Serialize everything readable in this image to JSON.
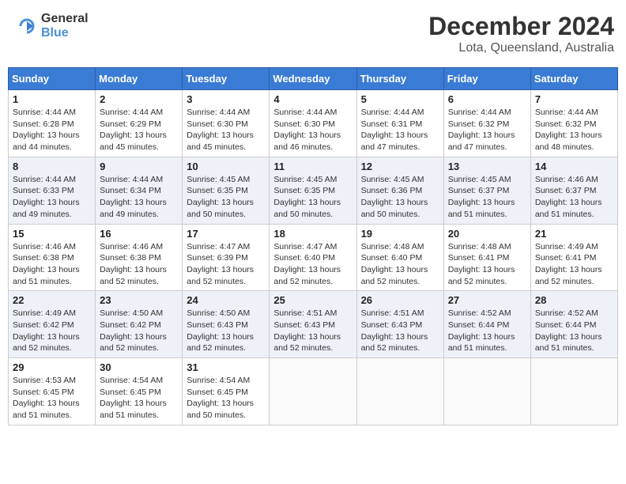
{
  "header": {
    "logo_general": "General",
    "logo_blue": "Blue",
    "month_title": "December 2024",
    "location": "Lota, Queensland, Australia"
  },
  "days_of_week": [
    "Sunday",
    "Monday",
    "Tuesday",
    "Wednesday",
    "Thursday",
    "Friday",
    "Saturday"
  ],
  "weeks": [
    [
      {
        "day": "1",
        "sunrise": "4:44 AM",
        "sunset": "6:28 PM",
        "daylight": "13 hours and 44 minutes."
      },
      {
        "day": "2",
        "sunrise": "4:44 AM",
        "sunset": "6:29 PM",
        "daylight": "13 hours and 45 minutes."
      },
      {
        "day": "3",
        "sunrise": "4:44 AM",
        "sunset": "6:30 PM",
        "daylight": "13 hours and 45 minutes."
      },
      {
        "day": "4",
        "sunrise": "4:44 AM",
        "sunset": "6:30 PM",
        "daylight": "13 hours and 46 minutes."
      },
      {
        "day": "5",
        "sunrise": "4:44 AM",
        "sunset": "6:31 PM",
        "daylight": "13 hours and 47 minutes."
      },
      {
        "day": "6",
        "sunrise": "4:44 AM",
        "sunset": "6:32 PM",
        "daylight": "13 hours and 47 minutes."
      },
      {
        "day": "7",
        "sunrise": "4:44 AM",
        "sunset": "6:32 PM",
        "daylight": "13 hours and 48 minutes."
      }
    ],
    [
      {
        "day": "8",
        "sunrise": "4:44 AM",
        "sunset": "6:33 PM",
        "daylight": "13 hours and 49 minutes."
      },
      {
        "day": "9",
        "sunrise": "4:44 AM",
        "sunset": "6:34 PM",
        "daylight": "13 hours and 49 minutes."
      },
      {
        "day": "10",
        "sunrise": "4:45 AM",
        "sunset": "6:35 PM",
        "daylight": "13 hours and 50 minutes."
      },
      {
        "day": "11",
        "sunrise": "4:45 AM",
        "sunset": "6:35 PM",
        "daylight": "13 hours and 50 minutes."
      },
      {
        "day": "12",
        "sunrise": "4:45 AM",
        "sunset": "6:36 PM",
        "daylight": "13 hours and 50 minutes."
      },
      {
        "day": "13",
        "sunrise": "4:45 AM",
        "sunset": "6:37 PM",
        "daylight": "13 hours and 51 minutes."
      },
      {
        "day": "14",
        "sunrise": "4:46 AM",
        "sunset": "6:37 PM",
        "daylight": "13 hours and 51 minutes."
      }
    ],
    [
      {
        "day": "15",
        "sunrise": "4:46 AM",
        "sunset": "6:38 PM",
        "daylight": "13 hours and 51 minutes."
      },
      {
        "day": "16",
        "sunrise": "4:46 AM",
        "sunset": "6:38 PM",
        "daylight": "13 hours and 52 minutes."
      },
      {
        "day": "17",
        "sunrise": "4:47 AM",
        "sunset": "6:39 PM",
        "daylight": "13 hours and 52 minutes."
      },
      {
        "day": "18",
        "sunrise": "4:47 AM",
        "sunset": "6:40 PM",
        "daylight": "13 hours and 52 minutes."
      },
      {
        "day": "19",
        "sunrise": "4:48 AM",
        "sunset": "6:40 PM",
        "daylight": "13 hours and 52 minutes."
      },
      {
        "day": "20",
        "sunrise": "4:48 AM",
        "sunset": "6:41 PM",
        "daylight": "13 hours and 52 minutes."
      },
      {
        "day": "21",
        "sunrise": "4:49 AM",
        "sunset": "6:41 PM",
        "daylight": "13 hours and 52 minutes."
      }
    ],
    [
      {
        "day": "22",
        "sunrise": "4:49 AM",
        "sunset": "6:42 PM",
        "daylight": "13 hours and 52 minutes."
      },
      {
        "day": "23",
        "sunrise": "4:50 AM",
        "sunset": "6:42 PM",
        "daylight": "13 hours and 52 minutes."
      },
      {
        "day": "24",
        "sunrise": "4:50 AM",
        "sunset": "6:43 PM",
        "daylight": "13 hours and 52 minutes."
      },
      {
        "day": "25",
        "sunrise": "4:51 AM",
        "sunset": "6:43 PM",
        "daylight": "13 hours and 52 minutes."
      },
      {
        "day": "26",
        "sunrise": "4:51 AM",
        "sunset": "6:43 PM",
        "daylight": "13 hours and 52 minutes."
      },
      {
        "day": "27",
        "sunrise": "4:52 AM",
        "sunset": "6:44 PM",
        "daylight": "13 hours and 51 minutes."
      },
      {
        "day": "28",
        "sunrise": "4:52 AM",
        "sunset": "6:44 PM",
        "daylight": "13 hours and 51 minutes."
      }
    ],
    [
      {
        "day": "29",
        "sunrise": "4:53 AM",
        "sunset": "6:45 PM",
        "daylight": "13 hours and 51 minutes."
      },
      {
        "day": "30",
        "sunrise": "4:54 AM",
        "sunset": "6:45 PM",
        "daylight": "13 hours and 51 minutes."
      },
      {
        "day": "31",
        "sunrise": "4:54 AM",
        "sunset": "6:45 PM",
        "daylight": "13 hours and 50 minutes."
      },
      null,
      null,
      null,
      null
    ]
  ]
}
